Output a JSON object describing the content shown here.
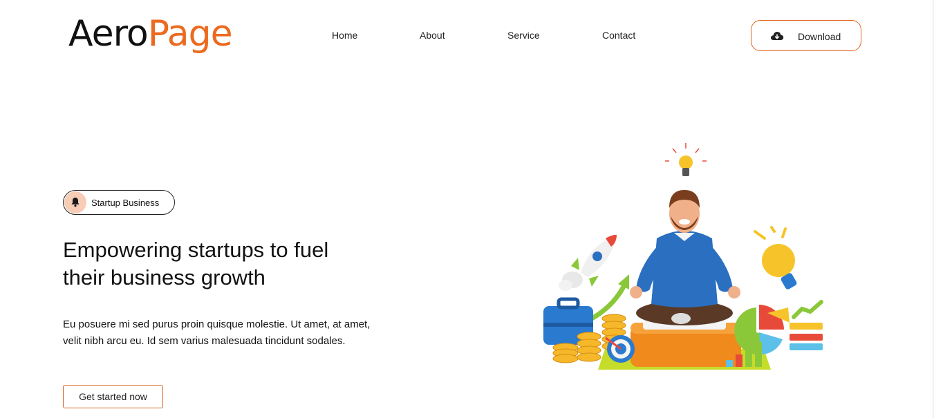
{
  "header": {
    "logo": {
      "part1": "Aero",
      "part2": "Page"
    },
    "nav": [
      {
        "label": "Home"
      },
      {
        "label": "About"
      },
      {
        "label": "Service"
      },
      {
        "label": "Contact"
      }
    ],
    "download_label": "Download"
  },
  "hero": {
    "badge_label": "Startup Business",
    "title": "Empowering startups to fuel their business growth",
    "description": "Eu posuere mi sed purus proin quisque molestie. Ut amet, at amet, velit nibh arcu eu. Id sem varius malesuada tincidunt sodales.",
    "cta_label": "Get started now"
  },
  "colors": {
    "brand_orange": "#ec6a1f",
    "badge_bg": "#f7cdb6",
    "text": "#111111"
  },
  "icons": {
    "download": "cloud-download-icon",
    "badge": "bell-icon"
  }
}
